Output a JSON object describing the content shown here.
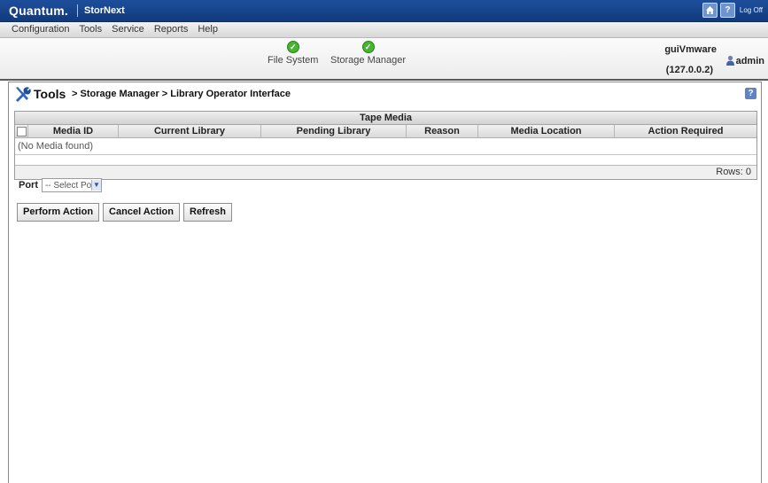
{
  "app": {
    "brand": "Quantum.",
    "product": "StorNext",
    "logoff": "Log Off",
    "home_icon": "home-icon",
    "help_icon": "help-icon"
  },
  "menu": [
    "Configuration",
    "Tools",
    "Service",
    "Reports",
    "Help"
  ],
  "status": [
    {
      "label": "File System",
      "icon": "ok-check-icon"
    },
    {
      "label": "Storage Manager",
      "icon": "ok-check-icon"
    }
  ],
  "user": {
    "host": "guiVmware",
    "ip": "(127.0.0.2)",
    "name": "admin"
  },
  "page": {
    "section": "Tools",
    "breadcrumb": "> Storage Manager > Library Operator Interface"
  },
  "table": {
    "title": "Tape Media",
    "columns": [
      "Media ID",
      "Current Library",
      "Pending Library",
      "Reason",
      "Media Location",
      "Action Required"
    ],
    "empty_text": "(No Media found)",
    "rows_label": "Rows: 0"
  },
  "port": {
    "label": "Port",
    "selected": "-- Select Port --"
  },
  "actions": {
    "perform": "Perform Action",
    "cancel": "Cancel Action",
    "refresh": "Refresh"
  }
}
